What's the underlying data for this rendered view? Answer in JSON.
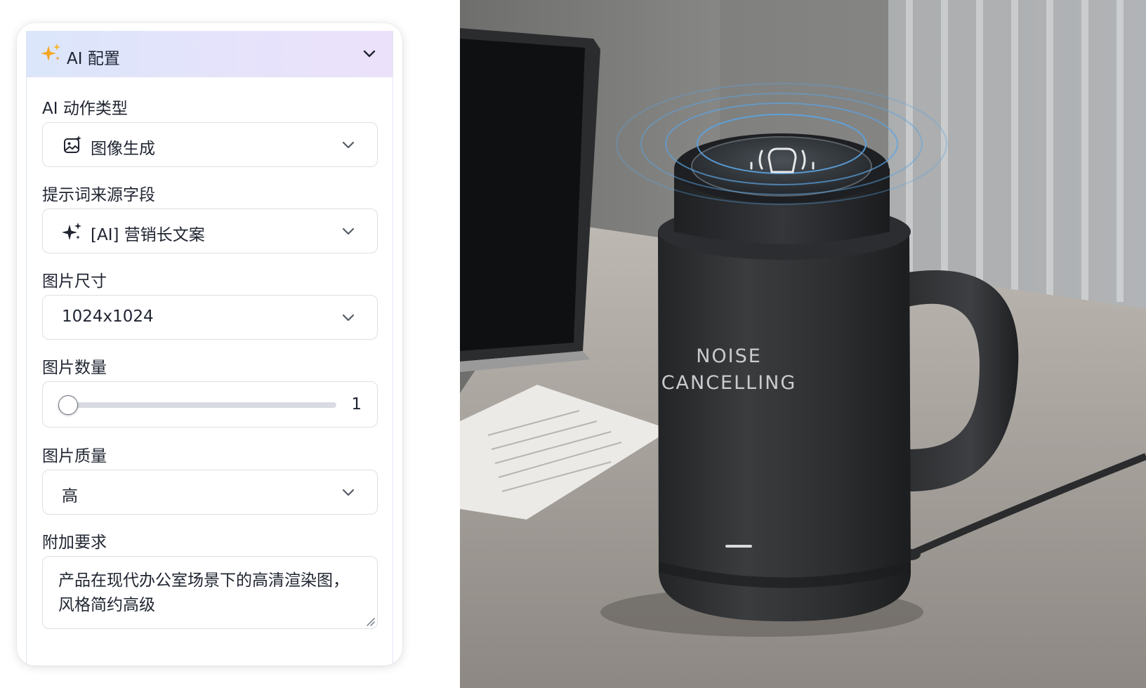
{
  "panel": {
    "title": "AI 配置",
    "fields": {
      "action_type": {
        "label": "AI 动作类型",
        "value": "图像生成",
        "icon": "image-sparkle-icon"
      },
      "prompt_source": {
        "label": "提示词来源字段",
        "value": "[AI] 营销长文案",
        "icon": "sparkle-icon"
      },
      "image_size": {
        "label": "图片尺寸",
        "value": "1024x1024"
      },
      "image_count": {
        "label": "图片数量",
        "value": "1",
        "min_fraction": 0
      },
      "image_quality": {
        "label": "图片质量",
        "value": "高"
      },
      "extra_requirements": {
        "label": "附加要求",
        "value": "产品在现代办公室场景下的高清渲染图，风格简约高级"
      }
    }
  },
  "photo": {
    "mug_text_line1": "NOISE",
    "mug_text_line2": "CANCELLING"
  },
  "colors": {
    "header_gradient_start": "#dbe6fb",
    "header_gradient_end": "#ece1fa",
    "sparkle_orange": "#f5a623",
    "mug_body": "#2f3133"
  }
}
